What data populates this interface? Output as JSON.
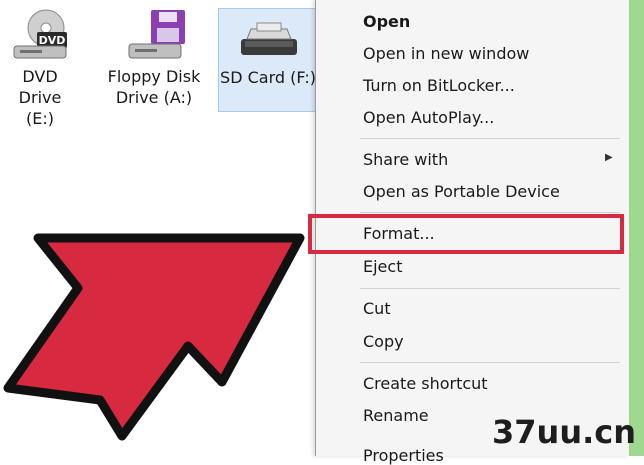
{
  "drives": {
    "dvd": {
      "line1": "DVD Drive",
      "line2": "(E:)",
      "icon": "dvd-drive-icon"
    },
    "floppy": {
      "line1": "Floppy Disk",
      "line2": "Drive (A:)",
      "icon": "floppy-drive-icon"
    },
    "sd": {
      "line1": "SD Card (F:)",
      "icon": "sd-card-icon"
    }
  },
  "menu": {
    "open": "Open",
    "open_new_window": "Open in new window",
    "bitlocker": "Turn on BitLocker...",
    "autoplay": "Open AutoPlay...",
    "share_with": "Share with",
    "portable_device": "Open as Portable Device",
    "format": "Format...",
    "eject": "Eject",
    "cut": "Cut",
    "copy": "Copy",
    "create_shortcut": "Create shortcut",
    "rename": "Rename",
    "properties": "Properties"
  },
  "colors": {
    "highlight": "#d72a41",
    "arrow": "#d72a41",
    "selection": "#dbe9f8"
  },
  "watermark": "37uu.cn"
}
